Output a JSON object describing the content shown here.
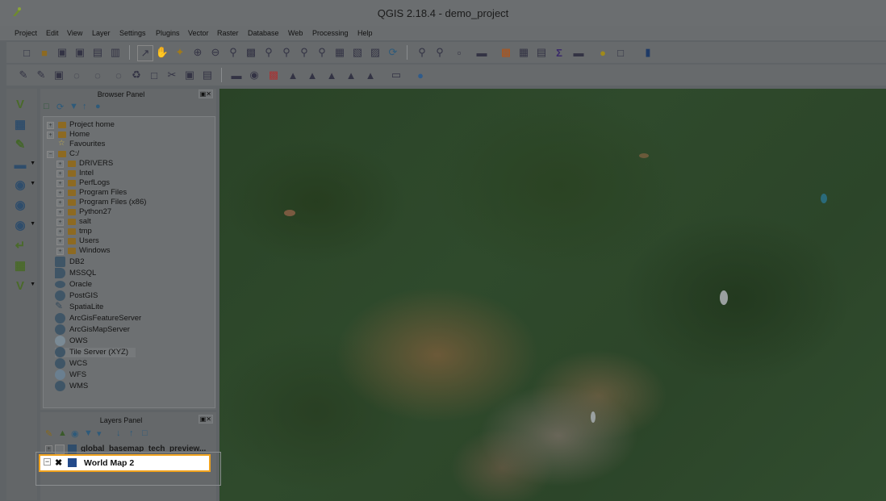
{
  "window": {
    "title": "QGIS 2.18.4 - demo_project"
  },
  "menu": [
    "Project",
    "Edit",
    "View",
    "Layer",
    "Settings",
    "Plugins",
    "Vector",
    "Raster",
    "Database",
    "Web",
    "Processing",
    "Help"
  ],
  "browser_panel": {
    "title": "Browser Panel",
    "tree": {
      "project_home": "Project home",
      "home": "Home",
      "favourites": "Favourites",
      "drive": "C:/",
      "folders": [
        "DRIVERS",
        "Intel",
        "PerfLogs",
        "Program Files",
        "Program Files (x86)",
        "Python27",
        "salt",
        "tmp",
        "Users",
        "Windows"
      ],
      "providers": [
        "DB2",
        "MSSQL",
        "Oracle",
        "PostGIS",
        "SpatiaLite",
        "ArcGisFeatureServer",
        "ArcGisMapServer",
        "OWS",
        "Tile Server (XYZ)",
        "WCS",
        "WFS",
        "WMS"
      ]
    }
  },
  "layers_panel": {
    "title": "Layers Panel",
    "layers": [
      "global_basemap_tech_preview...",
      "World Map 2"
    ]
  },
  "colors": {
    "highlight_border": "#f0a21e",
    "overlay": "#5f6366"
  }
}
